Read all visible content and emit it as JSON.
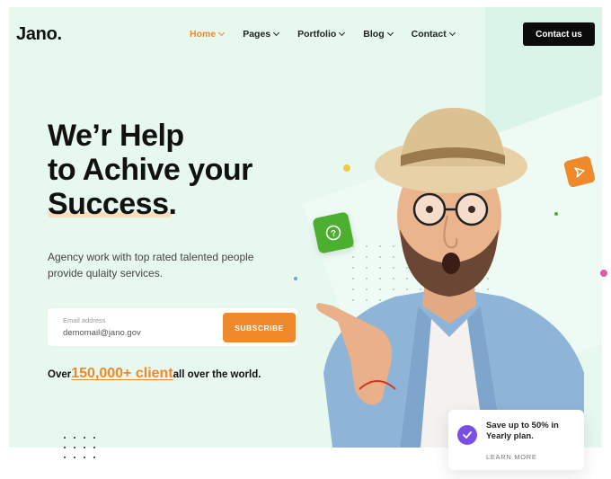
{
  "header": {
    "logo": "Jano.",
    "nav": [
      {
        "label": "Home",
        "active": true
      },
      {
        "label": "Pages",
        "active": false
      },
      {
        "label": "Portfolio",
        "active": false
      },
      {
        "label": "Blog",
        "active": false
      },
      {
        "label": "Contact",
        "active": false
      }
    ],
    "cta_label": "Contact us"
  },
  "hero": {
    "headline": [
      "We’r Help",
      "to Achive your",
      "Success."
    ],
    "subtext": "Agency work with top rated talented people provide qulaity services.",
    "email_label": "Email address",
    "email_value": "demomail@jano.gov",
    "subscribe_label": "SUBSCRIBE",
    "clients_prefix": "Over",
    "clients_highlight": "150,000+ client",
    "clients_suffix": "all over the world."
  },
  "promo": {
    "title": "Save up to 50% in Yearly plan.",
    "link": "LEARN MORE"
  },
  "colors": {
    "accent": "#ee8a2c",
    "hero_bg": "#e7f8ef",
    "dark": "#0b0b0b",
    "green": "#4caf2f",
    "purple": "#7b4ee6"
  },
  "icons": [
    "question-bubble-icon",
    "play-send-icon",
    "check-icon",
    "chevron-down-icon"
  ]
}
